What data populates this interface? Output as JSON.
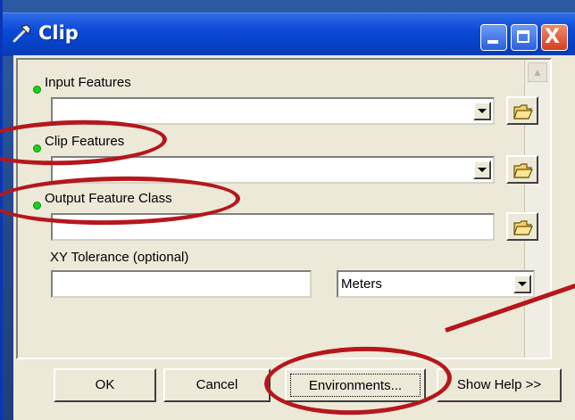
{
  "window": {
    "title": "Clip",
    "title_icon": "hammer-icon",
    "controls": [
      "minimize-icon",
      "maximize-icon",
      "close-icon"
    ],
    "close_glyph": "X"
  },
  "form": {
    "input_features": {
      "label": "Input Features",
      "value": "",
      "required": true
    },
    "clip_features": {
      "label": "Clip Features",
      "value": "",
      "required": true
    },
    "output_feature_class": {
      "label": "Output Feature Class",
      "value": "",
      "required": true
    },
    "xy_tolerance": {
      "label": "XY Tolerance (optional)",
      "value": "",
      "units_value": "Meters"
    }
  },
  "buttons": {
    "ok": "OK",
    "cancel": "Cancel",
    "environments": "Environments...",
    "show_help": "Show Help >>"
  },
  "annotation": {
    "color": "#b5171c"
  },
  "colors": {
    "titlebar": "#0b49d8",
    "dialog_bg": "#ece9d8",
    "required_dot": "#19d11b"
  }
}
